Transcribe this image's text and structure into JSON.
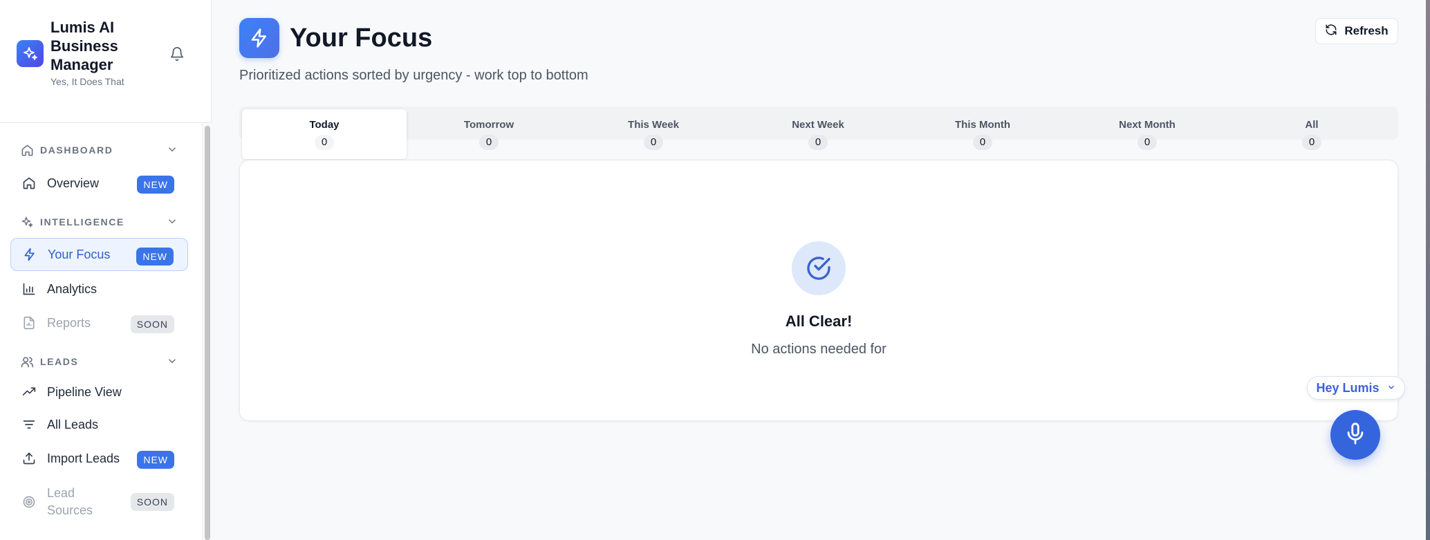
{
  "brand": {
    "name": "Lumis AI Business Manager",
    "tagline": "Yes, It Does That"
  },
  "sidebar": {
    "sections": [
      {
        "label": "DASHBOARD",
        "items": [
          {
            "label": "Overview",
            "badge": "NEW"
          }
        ]
      },
      {
        "label": "INTELLIGENCE",
        "items": [
          {
            "label": "Your Focus",
            "badge": "NEW",
            "active": true
          },
          {
            "label": "Analytics",
            "badge": ""
          },
          {
            "label": "Reports",
            "badge": "SOON",
            "disabled": true
          }
        ]
      },
      {
        "label": "LEADS",
        "items": [
          {
            "label": "Pipeline View",
            "badge": ""
          },
          {
            "label": "All Leads",
            "badge": ""
          },
          {
            "label": "Import Leads",
            "badge": "NEW"
          },
          {
            "label": "Lead Sources",
            "badge": "SOON",
            "disabled": true
          }
        ]
      }
    ]
  },
  "header": {
    "title": "Your Focus",
    "subtitle": "Prioritized actions sorted by urgency - work top to bottom",
    "refresh_label": "Refresh"
  },
  "tabs": [
    {
      "label": "Today",
      "count": "0",
      "active": true
    },
    {
      "label": "Tomorrow",
      "count": "0"
    },
    {
      "label": "This Week",
      "count": "0"
    },
    {
      "label": "Next Week",
      "count": "0"
    },
    {
      "label": "This Month",
      "count": "0"
    },
    {
      "label": "Next Month",
      "count": "0"
    },
    {
      "label": "All",
      "count": "0"
    }
  ],
  "empty_state": {
    "title": "All Clear!",
    "message": "No actions needed for"
  },
  "assistant": {
    "label": "Hey Lumis"
  },
  "colors": {
    "accent": "#3b74e8",
    "active_bg": "#eef4ff",
    "active_text": "#2f5ec9",
    "mic": "#3565dd"
  }
}
